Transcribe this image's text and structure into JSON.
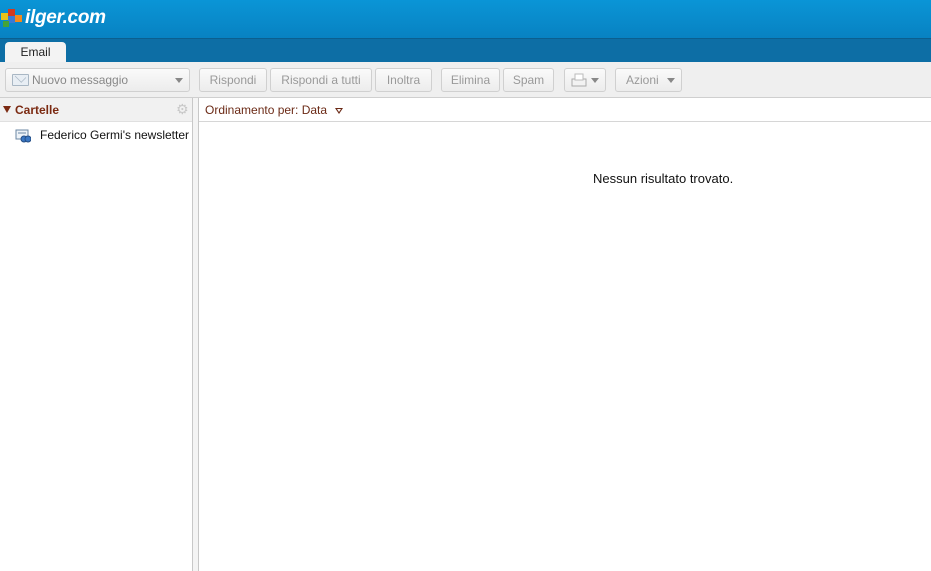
{
  "header": {
    "brand": "ilger.com"
  },
  "tabs": [
    {
      "label": "Email"
    }
  ],
  "toolbar": {
    "new_message": "Nuovo messaggio",
    "reply": "Rispondi",
    "reply_all": "Rispondi a tutti",
    "forward": "Inoltra",
    "delete": "Elimina",
    "spam": "Spam",
    "move_icon": "archive-box-icon",
    "actions": "Azioni"
  },
  "sidebar": {
    "title": "Cartelle",
    "items": [
      {
        "label": "Federico Germi's newsletter ",
        "icon": "newsletter-folder-icon"
      }
    ]
  },
  "main": {
    "sort_label": "Ordinamento per: Data",
    "empty_message": "Nessun risultato trovato."
  },
  "colors": {
    "header": "#0a95d6",
    "tabbar": "#0d6ea5",
    "folder_header_text": "#7b2a12"
  }
}
